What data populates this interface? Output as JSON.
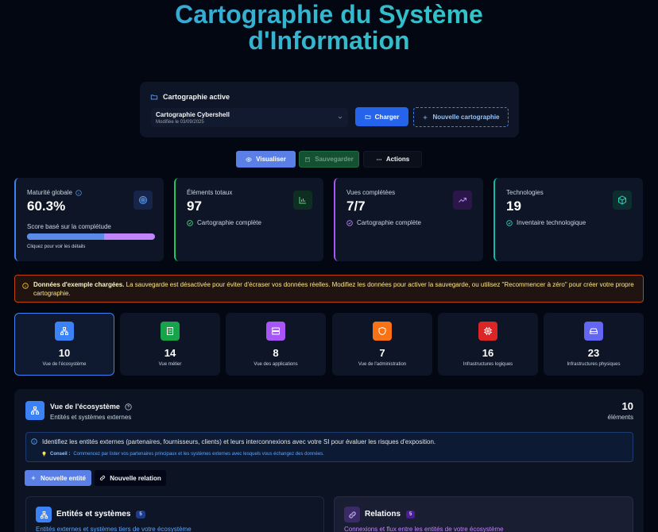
{
  "header": {
    "title_line1": "Cartographie du Système",
    "title_line2": "d'Information"
  },
  "active": {
    "heading": "Cartographie active",
    "selected_name": "Cartographie Cybershell",
    "selected_date": "Modifiée le 03/09/2025",
    "load_label": "Charger",
    "new_label": "Nouvelle cartographie"
  },
  "tabs": {
    "visualize": "Visualiser",
    "save": "Sauvegarder",
    "actions": "Actions"
  },
  "stats": [
    {
      "label": "Maturité globale",
      "value": "60.3%",
      "desc": "Score basé sur la complétude",
      "progress": 0.603,
      "hint": "Cliquez pour voir les détails",
      "color": "#3b82f6"
    },
    {
      "label": "Éléments totaux",
      "value": "97",
      "sub": "Cartographie complète",
      "color": "#22c55e"
    },
    {
      "label": "Vues complétées",
      "value": "7/7",
      "sub": "Cartographie complète",
      "color": "#a855f7"
    },
    {
      "label": "Technologies",
      "value": "19",
      "sub": "Inventaire technologique",
      "color": "#14b8a6"
    }
  ],
  "warning": {
    "bold": "Données d'exemple chargées.",
    "text": " La sauvegarde est désactivée pour éviter d'écraser vos données réelles. Modifiez les données pour activer la sauvegarde, ou utilisez \"Recommencer à zéro\" pour créer votre propre cartographie."
  },
  "views": [
    {
      "count": "10",
      "label": "Vue de l'écosystème",
      "color": "#3b82f6",
      "icon": "network-icon"
    },
    {
      "count": "14",
      "label": "Vue métier",
      "color": "#16a34a",
      "icon": "building-icon"
    },
    {
      "count": "8",
      "label": "Vue des applications",
      "color": "#a855f7",
      "icon": "server-icon"
    },
    {
      "count": "7",
      "label": "Vue de l'administration",
      "color": "#f97316",
      "icon": "shield-icon"
    },
    {
      "count": "16",
      "label": "Infrastructures logiques",
      "color": "#dc2626",
      "icon": "chip-icon"
    },
    {
      "count": "23",
      "label": "Infrastructures physiques",
      "color": "#6366f1",
      "icon": "hard-drive-icon"
    }
  ],
  "section": {
    "title": "Vue de l'écosystème",
    "subtitle": "Entités et systèmes externes",
    "count": "10",
    "count_label": "éléments",
    "info": "Identifiez les entités externes (partenaires, fournisseurs, clients) et leurs interconnexions avec votre SI pour évaluer les risques d'exposition.",
    "tip_label": "Conseil :",
    "tip_text": "Commencez par lister vos partenaires principaux et les systèmes externes avec lesquels vous échangez des données.",
    "new_entity": "Nouvelle entité",
    "new_relation": "Nouvelle relation",
    "entities": {
      "title": "Entités et systèmes",
      "count": "5",
      "subtitle": "Entités externes et systèmes tiers de votre écosystème"
    },
    "relations": {
      "title": "Relations",
      "count": "5",
      "subtitle": "Connexions et flux entre les entités de votre écosystème"
    }
  }
}
